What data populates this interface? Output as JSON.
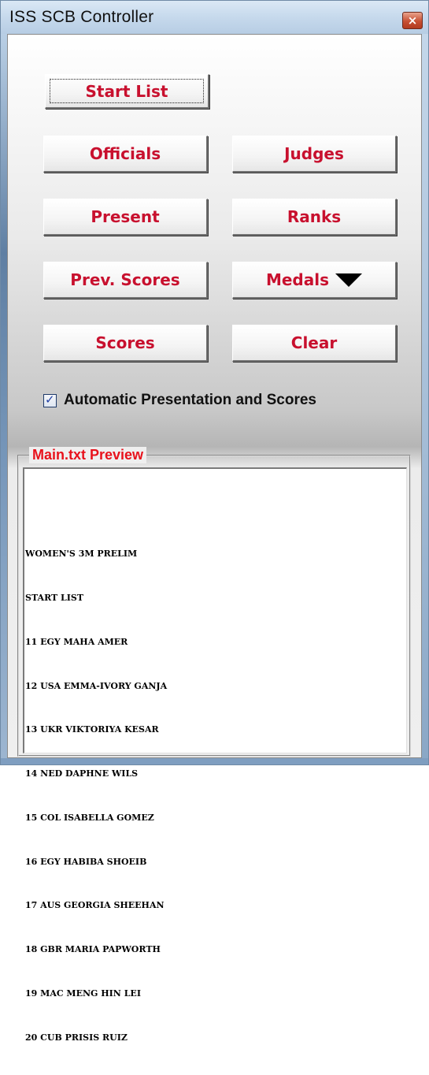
{
  "window": {
    "title": "ISS SCB Controller",
    "close_glyph": "×"
  },
  "buttons": {
    "start_list": "Start List",
    "officials": "Officials",
    "judges": "Judges",
    "present": "Present",
    "ranks": "Ranks",
    "prev_scores": "Prev. Scores",
    "medals": "Medals",
    "scores": "Scores",
    "clear": "Clear"
  },
  "options": {
    "auto_presentation_label": "Automatic Presentation and Scores",
    "auto_presentation_checked": true,
    "check_glyph": "✓"
  },
  "preview": {
    "group_label": "Main.txt Preview",
    "lines": [
      "WOMEN'S 3M PRELIM",
      "START LIST",
      "11 EGY MAHA AMER",
      "12 USA EMMA-IVORY GANJA",
      "13 UKR VIKTORIYA KESAR",
      "14 NED DAPHNE WILS",
      "15 COL ISABELLA GOMEZ",
      "16 EGY HABIBA SHOEIB",
      "17 AUS GEORGIA SHEEHAN",
      "18 GBR MARIA PAPWORTH",
      "19 MAC MENG HIN LEI",
      "20 CUB PRISIS RUIZ"
    ]
  },
  "icons": {
    "close": "close-icon",
    "medals_dropdown": "triangle-down-icon",
    "checkbox": "checkmark-icon"
  },
  "colors": {
    "button_text": "#c8102e",
    "group_label": "#e8121c",
    "title_bar": "#c6d9ec"
  }
}
